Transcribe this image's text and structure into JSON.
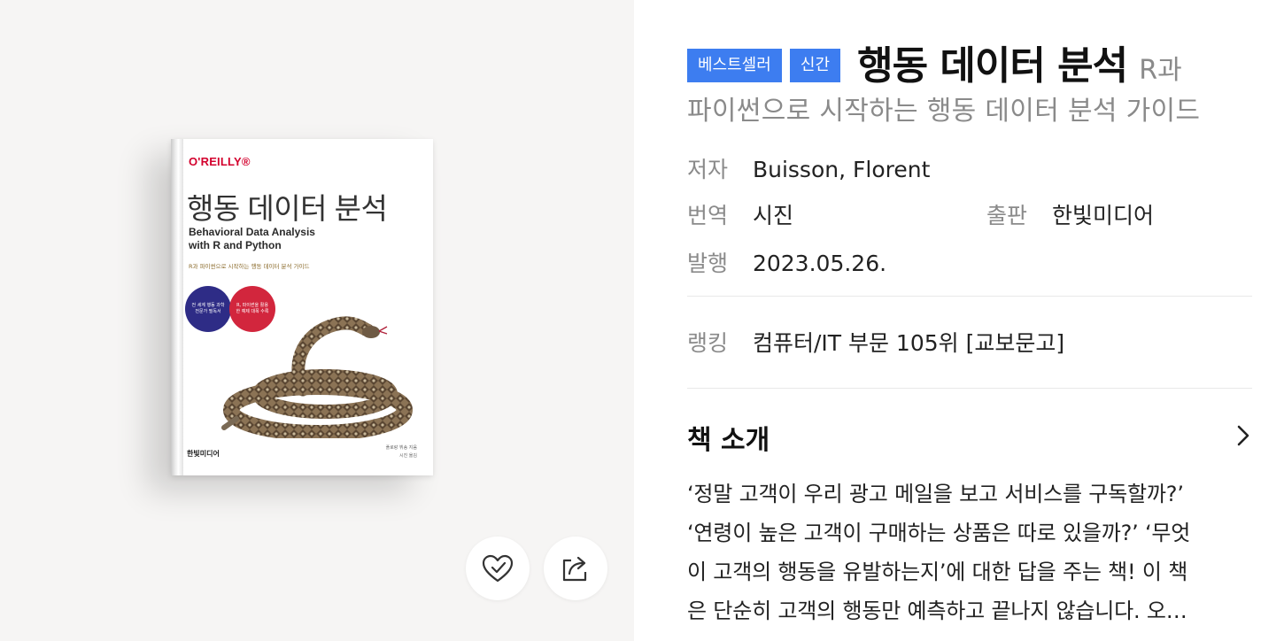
{
  "cover": {
    "publisher_logo": "O'REILLY®",
    "title": "행동 데이터 분석",
    "title_en_line1": "Behavioral Data Analysis",
    "title_en_line2": "with R and Python",
    "subtitle": "R과 파이썬으로 시작하는 행동 데이터 분석 가이드",
    "badge_blue": "전 세계 행동 과학 전문가 필독서",
    "badge_red": "R, 파이썬을 활용한 예제 대폭 수록",
    "imprint": "한빛미디어",
    "author_line": "플로랑 뷔송 지음",
    "translator_line": "시진 옮김"
  },
  "actions": {
    "like_icon": "heart-check-icon",
    "share_icon": "share-icon"
  },
  "tags": [
    "베스트셀러",
    "신간"
  ],
  "title": "행동 데이터 분석",
  "subtitle_part1": "R과",
  "subtitle_part2": "파이썬으로 시작하는 행동 데이터 분석 가이드",
  "meta": {
    "author_label": "저자",
    "author": "Buisson, Florent",
    "translator_label": "번역",
    "translator": "시진",
    "publisher_label": "출판",
    "publisher": "한빛미디어",
    "date_label": "발행",
    "date": "2023.05.26."
  },
  "ranking": {
    "label": "랭킹",
    "value": "컴퓨터/IT 부문 105위 [교보문고]"
  },
  "intro": {
    "title": "책 소개",
    "text": "‘정말 고객이 우리 광고 메일을 보고 서비스를 구독할까?’\n‘연령이 높은 고객이 구매하는 상품은 따로 있을까?’ ‘무엇\n이 고객의 행동을 유발하는지’에 대한 답을 주는 책! 이 책\n은 단순히 고객의 행동만 예측하고 끝나지 않습니다. 오…"
  },
  "colors": {
    "tag_bg": "#3d7df0",
    "left_bg": "#f6f5f4",
    "accent_red": "#d3002d"
  }
}
